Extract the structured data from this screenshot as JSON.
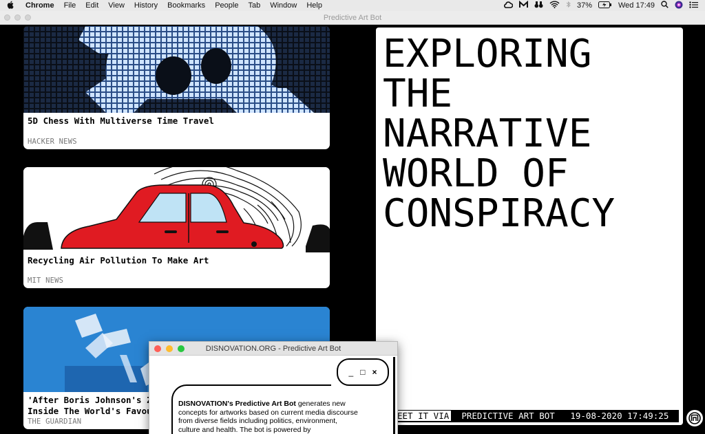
{
  "menubar": {
    "app": "Chrome",
    "items": [
      "File",
      "Edit",
      "View",
      "History",
      "Bookmarks",
      "People",
      "Tab",
      "Window",
      "Help"
    ],
    "battery": "37%",
    "clock": "Wed 17:49"
  },
  "browser": {
    "title": "Predictive Art Bot"
  },
  "cards": [
    {
      "headline": "5D Chess With Multiverse Time Travel",
      "source": "HACKER NEWS"
    },
    {
      "headline": "Recycling Air Pollution To Make Art",
      "source": "MIT NEWS"
    },
    {
      "headline_line1": "'After Boris Johnson's Zo",
      "headline_line2": "Inside The World's Favour",
      "source": "THE GUARDIAN"
    }
  ],
  "panel": {
    "title_lines": [
      "EXPLORING",
      "THE",
      "NARRATIVE",
      "WORLD OF",
      "CONSPIRACY"
    ],
    "ticker_lead": "EET IT VIA",
    "ticker_rest": "  PREDICTIVE ART BOT   19-08-2020 17:49:25"
  },
  "popup": {
    "title": "DISNOVATION.ORG - Predictive Art Bot",
    "minimize": "_",
    "maximize": "□",
    "close": "×",
    "intro_bold": "DISNOVATION's Predictive Art Bot",
    "intro_rest": " generates new concepts for artworks based on current media discourse from diverse fields including politics, environment, culture and health. The bot is powered by"
  },
  "colors": {
    "panel_bg": "#ffffff",
    "page_bg": "#000000",
    "popup_red": "#fe5f57",
    "popup_yellow": "#febc2e",
    "popup_green": "#28c840"
  }
}
